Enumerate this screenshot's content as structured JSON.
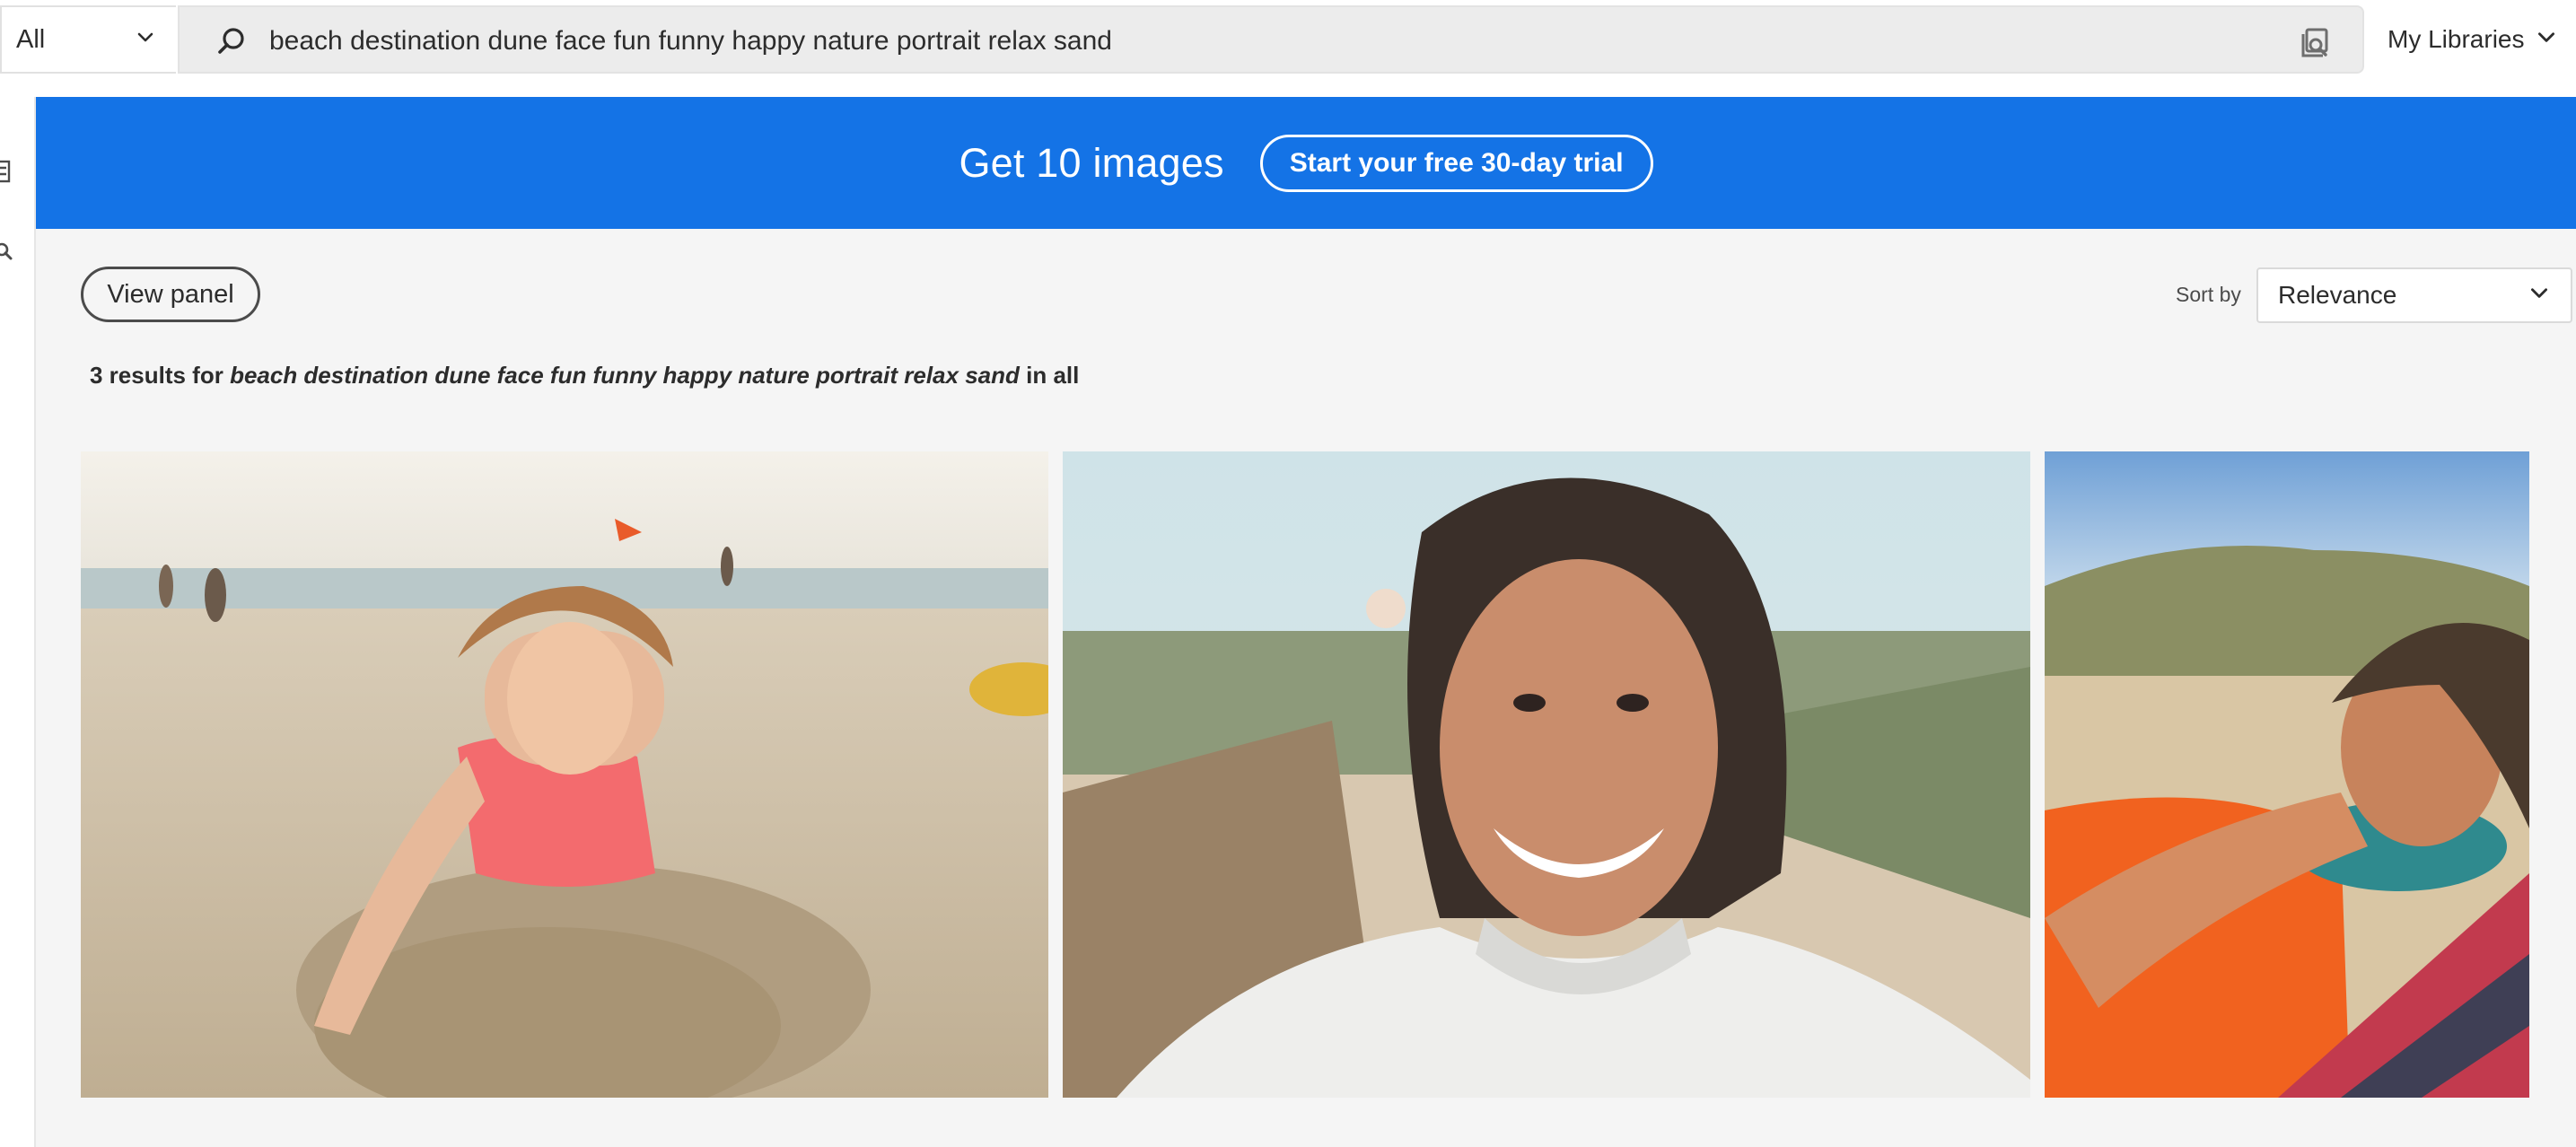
{
  "search": {
    "scope_value": "All",
    "query": "beach destination dune face fun funny happy nature portrait relax sand"
  },
  "header": {
    "libraries_label": "My Libraries"
  },
  "banner": {
    "headline": "Get 10 images",
    "cta_label": "Start your free 30-day trial",
    "color": "#1473e6"
  },
  "toolbar": {
    "view_panel_label": "View panel",
    "sort_label": "Sort by",
    "sort_value": "Relevance"
  },
  "results": {
    "count_text": "3 results for",
    "query_text": "beach destination dune face fun funny happy nature portrait relax sand",
    "suffix_text": "in all"
  },
  "images": [
    {
      "subject": "girl-buried-in-sand-on-beach"
    },
    {
      "subject": "smiling-woman-selfie-on-boardwalk"
    },
    {
      "subject": "woman-lying-on-towel-in-dunes"
    }
  ],
  "icons": {
    "scope_chevron": "chevron-down-icon",
    "search": "search-icon",
    "visual_search": "visual-search-icon",
    "libraries_chevron": "chevron-down-icon",
    "sort_chevron": "chevron-down-icon"
  }
}
